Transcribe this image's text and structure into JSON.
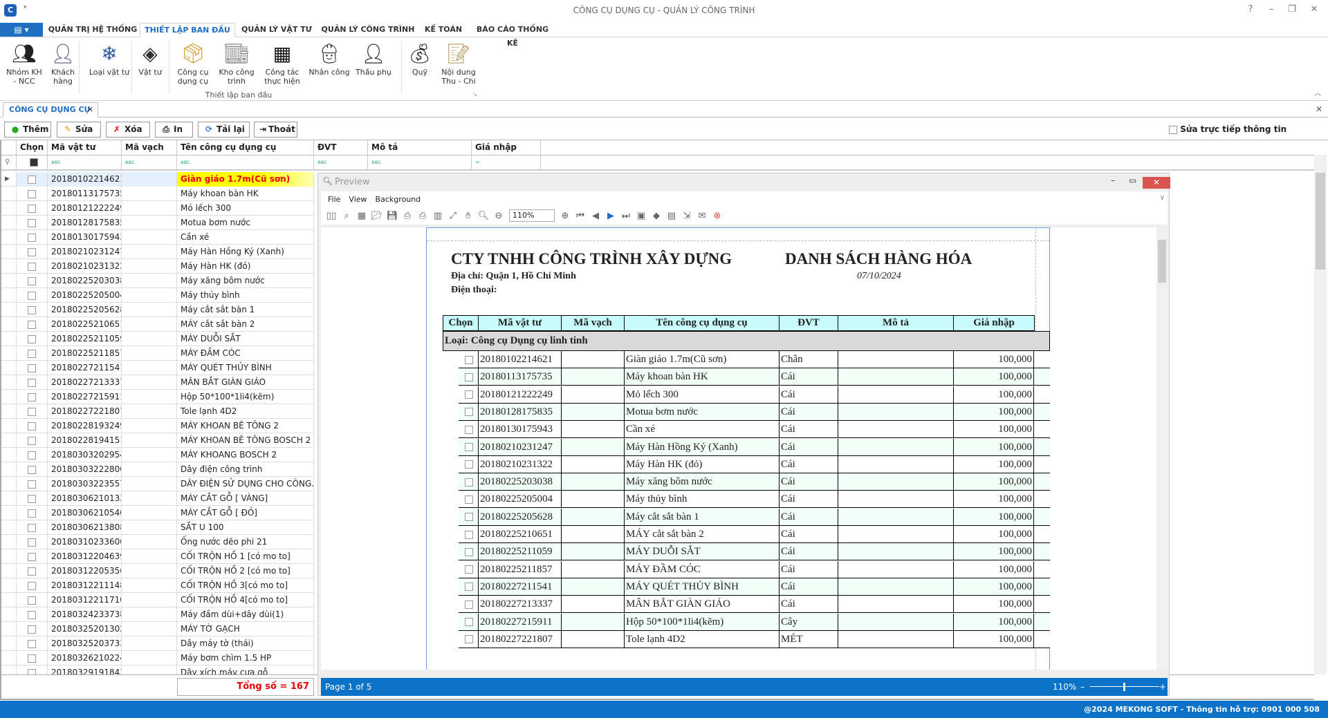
{
  "window": {
    "title": "CÔNG CỤ DỤNG CỤ - QUẢN LÝ CÔNG TRÌNH"
  },
  "ribbon": {
    "tabs": [
      {
        "label": "QUẢN TRỊ HỆ THỐNG"
      },
      {
        "label": "THIẾT LẬP BAN ĐẦU",
        "active": true
      },
      {
        "label": "QUẢN LÝ VẬT TƯ"
      },
      {
        "label": "QUẢN LÝ CÔNG TRÌNH"
      },
      {
        "label": "KẾ TOÁN"
      },
      {
        "label": "BÁO CÁO THỐNG KÊ"
      }
    ],
    "group_label": "Thiết lập ban đầu",
    "buttons": [
      {
        "label": "Nhóm KH\n- NCC",
        "icon": "users-group-icon"
      },
      {
        "label": "Khách\nhàng",
        "icon": "customer-icon"
      },
      {
        "label": "Loại vật tư",
        "icon": "material-type-icon"
      },
      {
        "label": "Vật tư",
        "icon": "material-icon"
      },
      {
        "label": "Công cụ\ndụng cụ",
        "icon": "tool-box-icon"
      },
      {
        "label": "Kho công\ntrình",
        "icon": "warehouse-icon"
      },
      {
        "label": "Công tác\nthực hiện",
        "icon": "building-icon"
      },
      {
        "label": "Nhân công",
        "icon": "worker-icon"
      },
      {
        "label": "Thầu phụ",
        "icon": "subcontractor-icon"
      },
      {
        "label": "Quỹ",
        "icon": "coins-icon"
      },
      {
        "label": "Nội dung\nThu - Chi",
        "icon": "document-list-icon"
      }
    ]
  },
  "doc_tab": {
    "label": "CÔNG CỤ DỤNG CỤ"
  },
  "toolbar": {
    "add": "Thêm",
    "edit": "Sửa",
    "delete": "Xóa",
    "print": "In",
    "reload": "Tải lại",
    "exit": "Thoát",
    "direct_edit_label": "Sửa trực tiếp thông tin"
  },
  "grid": {
    "columns": [
      "Chọn",
      "Mã vật tư",
      "Mã vạch",
      "Tên công cụ dụng cụ",
      "ĐVT",
      "Mô tả",
      "Giá nhập"
    ],
    "selected_index": 0,
    "rows": [
      [
        "20180102214621",
        "Giàn giáo 1.7m(Cũ sơn)"
      ],
      [
        "20180113175735",
        "Máy khoan bàn HK"
      ],
      [
        "20180121222249",
        "Mỏ lếch 300"
      ],
      [
        "20180128175835",
        "Motua bơm nước"
      ],
      [
        "20180130175943",
        "Cần xé"
      ],
      [
        "20180210231247",
        "Máy Hàn Hồng Ký (Xanh)"
      ],
      [
        "20180210231322",
        "Máy Hàn HK (đỏ)"
      ],
      [
        "20180225203038",
        "Máy xăng bôm nước"
      ],
      [
        "20180225205004",
        "Máy thủy bình"
      ],
      [
        "20180225205628",
        "Máy cắt sắt bàn 1"
      ],
      [
        "20180225210651",
        "MÁY cắt sắt bàn 2"
      ],
      [
        "20180225211059",
        "MÁY DUỖI SẮT"
      ],
      [
        "20180225211857",
        "MÁY ĐẦM CÓC"
      ],
      [
        "20180227211541",
        "MÁY QUÉT THỦY BÌNH"
      ],
      [
        "20180227213337",
        "MÂN BẮT GIÀN GIÁO"
      ],
      [
        "20180227215911",
        "Hộp 50*100*1li4(kẽm)"
      ],
      [
        "20180227221807",
        "Tole lạnh 4D2"
      ],
      [
        "20180228193249",
        "MÁY KHOAN BÊ TÔNG 2"
      ],
      [
        "20180228194151",
        "MÁY KHOAN BÊ TÔNG BOSCH 2"
      ],
      [
        "20180303202954",
        "MÁY KHOANG BOSCH 2"
      ],
      [
        "20180303222800",
        "Dây điện công trình"
      ],
      [
        "20180303223557",
        "DÂY ĐIỆN SỬ DỤNG CHO CÔNG..."
      ],
      [
        "20180306210133",
        "MÁY CẮT GỖ [ VÀNG]"
      ],
      [
        "20180306210540",
        "MÁY CẮT GỖ [ ĐỎ]"
      ],
      [
        "20180306213808",
        "SẮT U 100"
      ],
      [
        "20180310233600",
        "Ống nước dẽo phi 21"
      ],
      [
        "20180312204639",
        "CỐI TRỘN HỒ 1 [có mo to]"
      ],
      [
        "20180312205356",
        "CỐI TRỘN HỒ 2 [có mo to]"
      ],
      [
        "20180312211148",
        "CỐI TRỘN HỒ 3[có mo to]"
      ],
      [
        "20180312211710",
        "CỐI TRỘN HỒ 4[có mo to]"
      ],
      [
        "20180324233738",
        "Máy đầm dùi+dây dùi(1)"
      ],
      [
        "20180325201302",
        "MÁY TỜ GẠCH"
      ],
      [
        "20180325203733",
        "Dây máy tờ (thái)"
      ],
      [
        "20180326210224",
        "Máy bơm chìm 1.5 HP"
      ],
      [
        "20180329191843",
        "Dây xích máy cưa gỗ"
      ]
    ],
    "total_label": "Tổng số = 167"
  },
  "preview": {
    "title": "Preview",
    "menu": [
      "File",
      "View",
      "Background"
    ],
    "zoom_value": "110%",
    "toolbar_icons": [
      "document-map-icon",
      "find-icon",
      "parameters-icon",
      "open-icon",
      "save-icon",
      "print-icon",
      "quick-print-icon",
      "page-setup-icon",
      "scale-icon",
      "hand-tool-icon",
      "magnifier-icon",
      "zoom-out-icon",
      "zoom-in-icon",
      "first-page-icon",
      "previous-page-icon",
      "next-page-icon",
      "last-page-icon",
      "multiple-pages-icon",
      "color-icon",
      "watermark-icon",
      "export-icon",
      "email-icon",
      "close-preview-icon"
    ],
    "status_page": "Page 1 of 5",
    "status_zoom": "110%",
    "report": {
      "company": "CTY TNHH CÔNG TRÌNH XÂY DỰNG",
      "address": "Địa chỉ: Quận 1, Hồ Chí Minh",
      "phone": "Điện thoại:",
      "title": "DANH SÁCH HÀNG HÓA",
      "date": "07/10/2024",
      "columns": [
        "Chọn",
        "Mã vật tư",
        "Mã vạch",
        "Tên công cụ dụng cụ",
        "ĐVT",
        "Mô tả",
        "Giá nhập"
      ],
      "group": "Loại: Công cụ Dụng cụ linh tinh",
      "rows": [
        [
          "20180102214621",
          "Giàn giáo 1.7m(Cũ sơn)",
          "Chân",
          "100,000"
        ],
        [
          "20180113175735",
          "Máy khoan bàn HK",
          "Cái",
          "100,000"
        ],
        [
          "20180121222249",
          "Mỏ lếch 300",
          "Cái",
          "100,000"
        ],
        [
          "20180128175835",
          "Motua bơm nước",
          "Cái",
          "100,000"
        ],
        [
          "20180130175943",
          "Cần xé",
          "Cái",
          "100,000"
        ],
        [
          "20180210231247",
          "Máy Hàn Hồng Ký (Xanh)",
          "Cái",
          "100,000"
        ],
        [
          "20180210231322",
          "Máy Hàn HK (đỏ)",
          "Cái",
          "100,000"
        ],
        [
          "20180225203038",
          "Máy xăng bôm nước",
          "Cái",
          "100,000"
        ],
        [
          "20180225205004",
          "Máy thủy bình",
          "Cái",
          "100,000"
        ],
        [
          "20180225205628",
          "Máy cắt sắt bàn 1",
          "Cái",
          "100,000"
        ],
        [
          "20180225210651",
          "MÁY cắt sắt bàn 2",
          "Cái",
          "100,000"
        ],
        [
          "20180225211059",
          "MÁY DUỖI SẮT",
          "Cái",
          "100,000"
        ],
        [
          "20180225211857",
          "MÁY ĐẦM CÓC",
          "Cái",
          "100,000"
        ],
        [
          "20180227211541",
          "MÁY QUÉT THỦY BÌNH",
          "Cái",
          "100,000"
        ],
        [
          "20180227213337",
          "MÂN BẮT GIÀN GIÁO",
          "Cái",
          "100,000"
        ],
        [
          "20180227215911",
          "Hộp 50*100*1li4(kẽm)",
          "Cây",
          "100,000"
        ],
        [
          "20180227221807",
          "Tole lạnh 4D2",
          "MÉT",
          "100,000"
        ]
      ]
    }
  },
  "statusbar": {
    "text": "@2024 MEKONG SOFT - Thông tin hỗ trợ: 0901 000 508"
  },
  "colors": {
    "accent": "#0a72c7",
    "selected_cell_bg": "#ffff00",
    "selected_text": "#e00000",
    "report_header_bg": "#c8fbfc",
    "close_button": "#d9534f"
  }
}
